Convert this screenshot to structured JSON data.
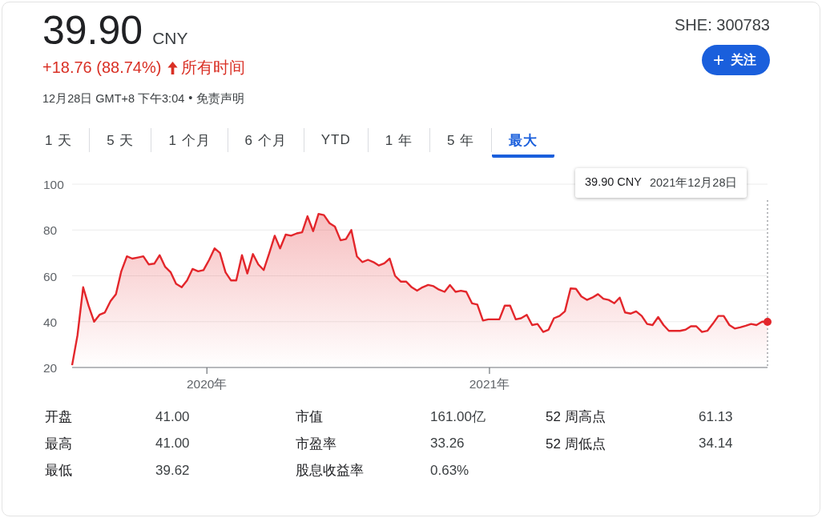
{
  "quote": {
    "price": "39.90",
    "currency": "CNY",
    "change": "+18.76 (88.74%)",
    "period": "所有时间",
    "timestamp": "12月28日 GMT+8 下午3:04",
    "separator": "•",
    "disclaimer": "免责声明"
  },
  "ticker": "SHE: 300783",
  "follow_button": {
    "icon": "+",
    "label": "关注"
  },
  "tabs": [
    {
      "label": "1 天",
      "selected": false
    },
    {
      "label": "5 天",
      "selected": false
    },
    {
      "label": "1 个月",
      "selected": false
    },
    {
      "label": "6 个月",
      "selected": false
    },
    {
      "label": "YTD",
      "selected": false
    },
    {
      "label": "1 年",
      "selected": false
    },
    {
      "label": "5 年",
      "selected": false
    },
    {
      "label": "最大",
      "selected": true
    }
  ],
  "chart": {
    "tooltip": {
      "price": "39.90 CNY",
      "date": "2021年12月28日"
    },
    "chart_data": {
      "type": "area",
      "grid": true,
      "xlim": [
        2019.523,
        2021.984
      ],
      "ylim": [
        20,
        100
      ],
      "yticks": [
        20,
        40,
        60,
        80,
        100
      ],
      "xticks": [
        {
          "value": 2020,
          "label": "2020年"
        },
        {
          "value": 2021,
          "label": "2021年"
        }
      ],
      "x": [
        2019.523,
        2019.542,
        2019.562,
        2019.581,
        2019.601,
        2019.62,
        2019.639,
        2019.659,
        2019.678,
        2019.697,
        2019.717,
        2019.736,
        2019.756,
        2019.775,
        2019.794,
        2019.814,
        2019.833,
        2019.852,
        2019.872,
        2019.891,
        2019.911,
        2019.93,
        2019.949,
        2019.969,
        2019.988,
        2020.008,
        2020.027,
        2020.046,
        2020.066,
        2020.085,
        2020.104,
        2020.124,
        2020.143,
        2020.163,
        2020.182,
        2020.201,
        2020.221,
        2020.24,
        2020.259,
        2020.279,
        2020.298,
        2020.318,
        2020.337,
        2020.356,
        2020.376,
        2020.395,
        2020.414,
        2020.434,
        2020.453,
        2020.473,
        2020.492,
        2020.511,
        2020.531,
        2020.55,
        2020.57,
        2020.589,
        2020.608,
        2020.628,
        2020.647,
        2020.666,
        2020.686,
        2020.705,
        2020.725,
        2020.744,
        2020.763,
        2020.783,
        2020.802,
        2020.821,
        2020.841,
        2020.86,
        2020.88,
        2020.899,
        2020.918,
        2020.938,
        2020.957,
        2020.977,
        2020.996,
        2021.015,
        2021.035,
        2021.054,
        2021.073,
        2021.093,
        2021.112,
        2021.132,
        2021.151,
        2021.17,
        2021.19,
        2021.209,
        2021.228,
        2021.248,
        2021.267,
        2021.287,
        2021.306,
        2021.325,
        2021.345,
        2021.364,
        2021.384,
        2021.403,
        2021.422,
        2021.442,
        2021.461,
        2021.48,
        2021.5,
        2021.519,
        2021.539,
        2021.558,
        2021.577,
        2021.597,
        2021.616,
        2021.635,
        2021.655,
        2021.674,
        2021.694,
        2021.713,
        2021.732,
        2021.752,
        2021.771,
        2021.79,
        2021.81,
        2021.829,
        2021.849,
        2021.868,
        2021.887,
        2021.907,
        2021.926,
        2021.945,
        2021.965,
        2021.984
      ],
      "series": [
        {
          "color": "#e3262b",
          "values": [
            21,
            34,
            55,
            47,
            40,
            43,
            44,
            49,
            52,
            62,
            68.5,
            67.5,
            68,
            68.5,
            65,
            65.3,
            69,
            64,
            61.5,
            56.5,
            55,
            58,
            63,
            62,
            62.5,
            67,
            72,
            70,
            61.5,
            58,
            58,
            69,
            61,
            69.5,
            65,
            62.5,
            70,
            77.5,
            72,
            78,
            77.5,
            78.5,
            79,
            86,
            79.5,
            87,
            86.5,
            83,
            81.5,
            75.5,
            76,
            80,
            68.5,
            66,
            67,
            66,
            64.5,
            65.5,
            67.5,
            60,
            57.5,
            57.5,
            55,
            53.5,
            55,
            56,
            55.5,
            54,
            53,
            56,
            53,
            53.5,
            53,
            48,
            47.5,
            40.5,
            41,
            41,
            41,
            47,
            47,
            41,
            41.5,
            43,
            38.5,
            39,
            35.5,
            36.5,
            41.5,
            42.5,
            44.5,
            54.5,
            54.3,
            51,
            49.5,
            50.5,
            52,
            50,
            49.5,
            48,
            50.5,
            44,
            43.5,
            44.5,
            42.5,
            39,
            38.5,
            42,
            38.5,
            36,
            36,
            36,
            36.5,
            38,
            38,
            35.5,
            36,
            39,
            42.5,
            42.5,
            38.5,
            37,
            37.5,
            38.2,
            39,
            38.5,
            40,
            39.9
          ]
        }
      ]
    }
  },
  "stats": [
    [
      {
        "label": "开盘",
        "value": "41.00"
      },
      {
        "label": "最高",
        "value": "41.00"
      },
      {
        "label": "最低",
        "value": "39.62"
      }
    ],
    [
      {
        "label": "市值",
        "value": "161.00亿"
      },
      {
        "label": "市盈率",
        "value": "33.26"
      },
      {
        "label": "股息收益率",
        "value": "0.63%"
      }
    ],
    [
      {
        "label": "52 周高点",
        "value": "61.13"
      },
      {
        "label": "52 周低点",
        "value": "34.14"
      }
    ]
  ]
}
